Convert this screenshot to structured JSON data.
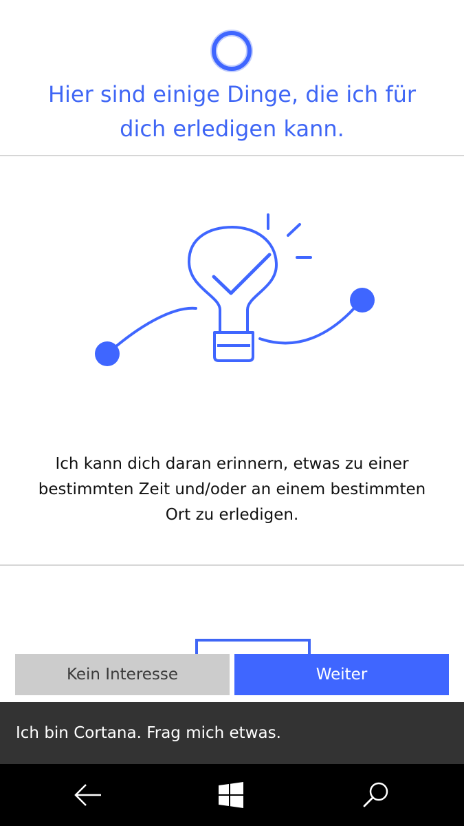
{
  "header": {
    "title_line1": "Hier sind einige Dinge, die ich für",
    "title_line2": "dich erledigen kann."
  },
  "card": {
    "illustration_icon": "lightbulb-checkmark-icon",
    "description_line1": "Ich kann dich daran erinnern, etwas zu einer",
    "description_line2": "bestimmten Zeit und/oder an einem bestimmten",
    "description_line3": "Ort zu erledigen."
  },
  "actions": {
    "decline_label": "Kein Interesse",
    "continue_label": "Weiter"
  },
  "ask_bar": {
    "prompt": "Ich bin Cortana. Frag mich etwas."
  },
  "navbar": {
    "back_icon": "back-arrow-icon",
    "start_icon": "windows-logo-icon",
    "search_icon": "search-icon"
  },
  "colors": {
    "accent": "#3f66ff",
    "heading_text": "#3f66f5",
    "decline_button_bg": "#cccccc",
    "ask_bar_bg": "#333333",
    "navbar_bg": "#000000"
  }
}
